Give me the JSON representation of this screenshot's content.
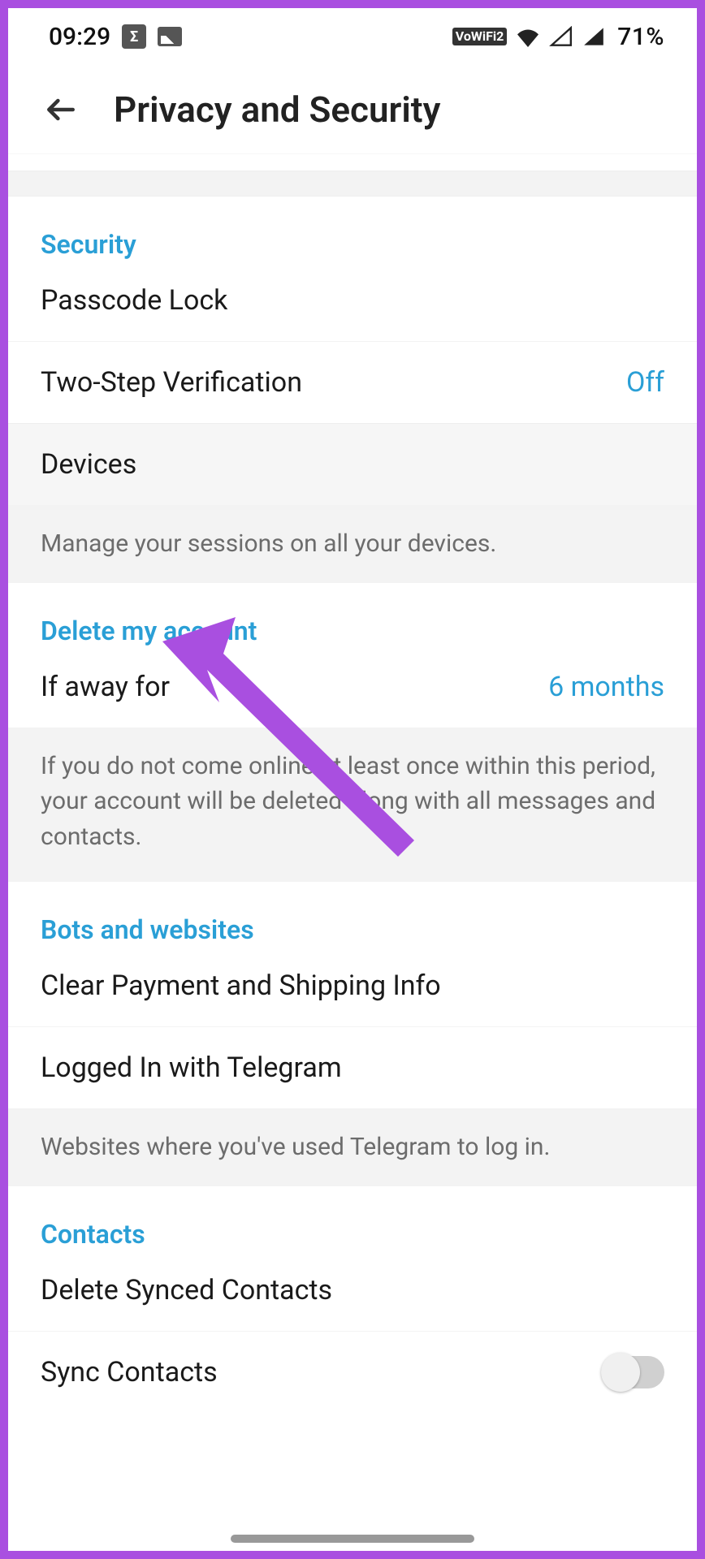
{
  "status": {
    "time": "09:29",
    "battery": "71%",
    "vowifi": "VoWiFi2"
  },
  "header": {
    "title": "Privacy and Security"
  },
  "sections": {
    "security": {
      "header": "Security",
      "passcode": "Passcode Lock",
      "twoStep": {
        "label": "Two-Step Verification",
        "value": "Off"
      },
      "devices": "Devices",
      "devicesInfo": "Manage your sessions on all your devices."
    },
    "delete": {
      "header": "Delete my account",
      "ifAway": {
        "label": "If away for",
        "value": "6 months"
      },
      "info": "If you do not come online at least once within this period, your account will be deleted along with all messages and contacts."
    },
    "bots": {
      "header": "Bots and websites",
      "clearPayment": "Clear Payment and Shipping Info",
      "loggedIn": "Logged In with Telegram",
      "info": "Websites where you've used Telegram to log in."
    },
    "contacts": {
      "header": "Contacts",
      "deleteSynced": "Delete Synced Contacts",
      "syncContacts": "Sync Contacts"
    }
  },
  "colors": {
    "accent": "#2a9fd6",
    "annotation": "#a94fe0"
  }
}
